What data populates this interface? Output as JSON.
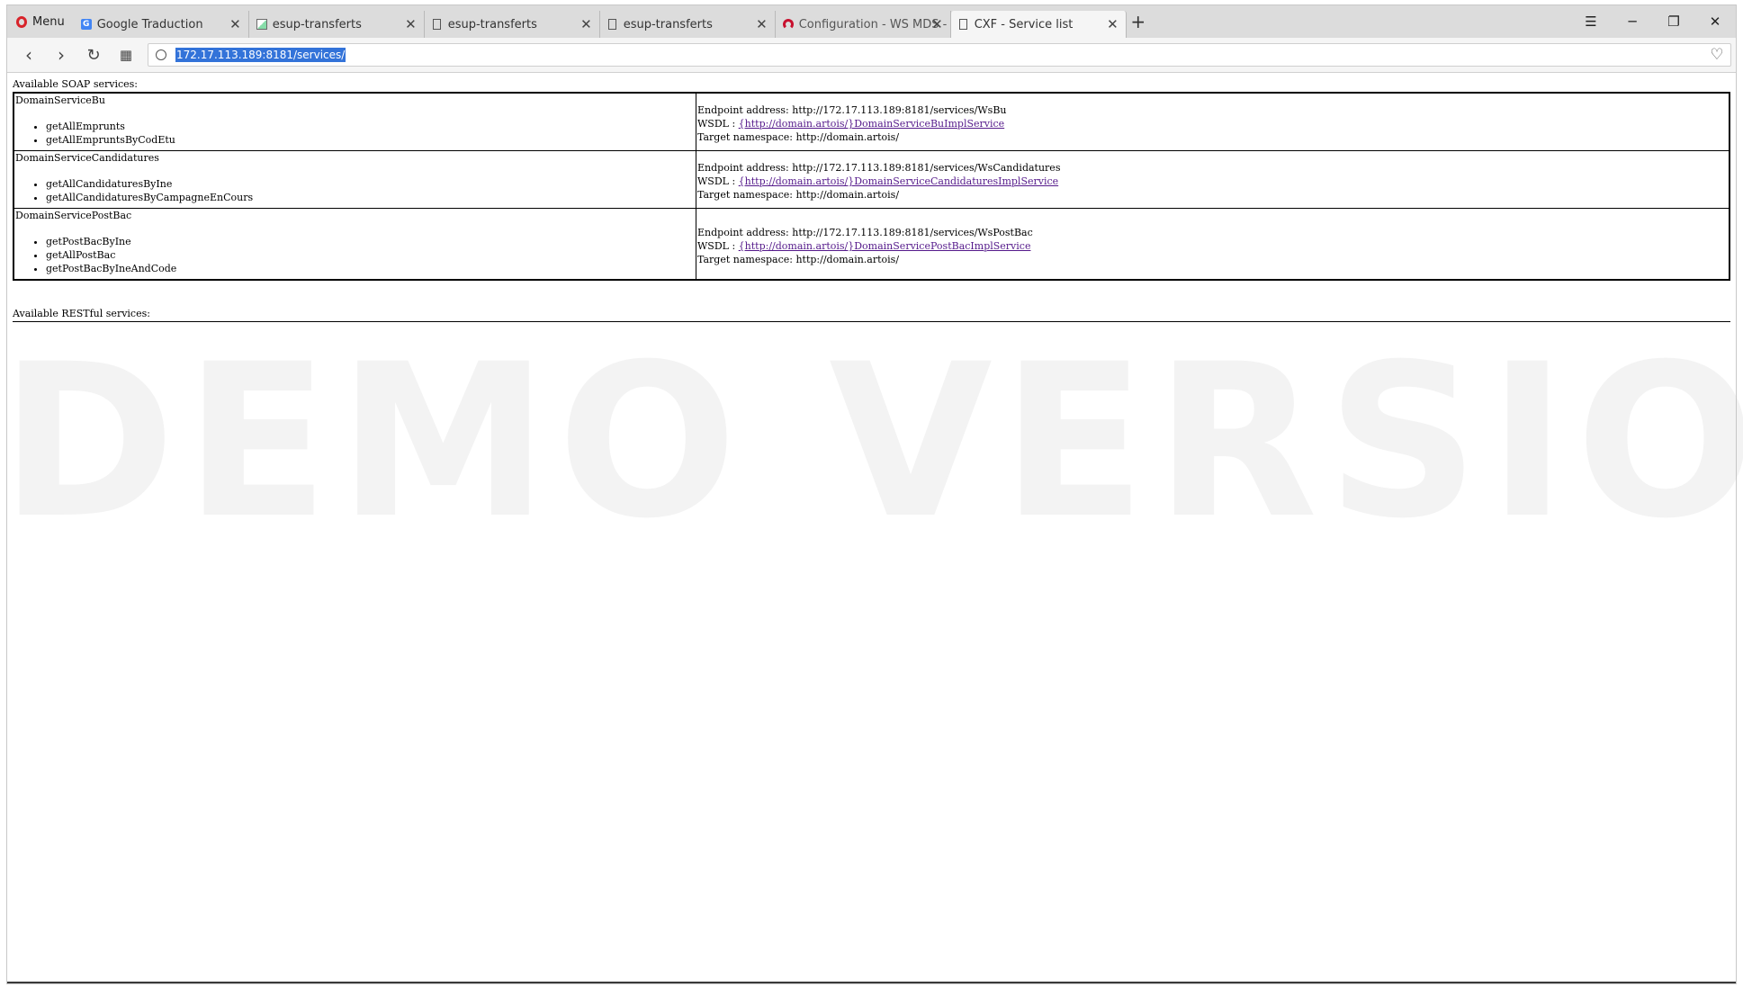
{
  "browser": {
    "menu_label": "Menu",
    "tabs": [
      {
        "title": "Google Traduction",
        "icon": "google-translate-icon"
      },
      {
        "title": "esup-transferts",
        "icon": "image-document-icon"
      },
      {
        "title": "esup-transferts",
        "icon": "document-icon"
      },
      {
        "title": "esup-transferts",
        "icon": "document-icon"
      },
      {
        "title": "Configuration - WS MDS -",
        "icon": "arc-logo-icon"
      },
      {
        "title": "CXF - Service list",
        "icon": "document-icon"
      }
    ],
    "url": "172.17.113.189:8181/services/"
  },
  "page": {
    "soap_heading": "Available SOAP services:",
    "services": [
      {
        "name": "DomainServiceBu",
        "operations": [
          "getAllEmprunts",
          "getAllEmpruntsByCodEtu"
        ],
        "endpoint": "Endpoint address: http://172.17.113.189:8181/services/WsBu",
        "wsdl_label": "WSDL : ",
        "wsdl_link": "{http://domain.artois/}DomainServiceBuImplService",
        "namespace": "Target namespace: http://domain.artois/"
      },
      {
        "name": "DomainServiceCandidatures",
        "operations": [
          "getAllCandidaturesByIne",
          "getAllCandidaturesByCampagneEnCours"
        ],
        "endpoint": "Endpoint address: http://172.17.113.189:8181/services/WsCandidatures",
        "wsdl_label": "WSDL : ",
        "wsdl_link": "{http://domain.artois/}DomainServiceCandidaturesImplService",
        "namespace": "Target namespace: http://domain.artois/"
      },
      {
        "name": "DomainServicePostBac",
        "operations": [
          "getPostBacByIne",
          "getAllPostBac",
          "getPostBacByIneAndCode"
        ],
        "endpoint": "Endpoint address: http://172.17.113.189:8181/services/WsPostBac",
        "wsdl_label": "WSDL : ",
        "wsdl_link": "{http://domain.artois/}DomainServicePostBacImplService",
        "namespace": "Target namespace: http://domain.artois/"
      }
    ],
    "rest_heading": "Available RESTful services:",
    "watermark": "DEMO VERSION"
  }
}
